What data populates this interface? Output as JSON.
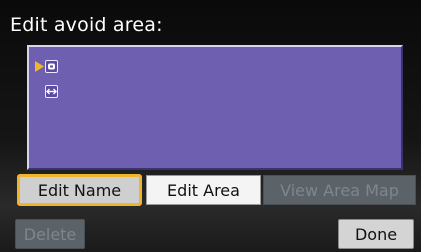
{
  "header": {
    "title": "Edit avoid area:"
  },
  "list": {
    "items": [
      {
        "icon": "avoid-area-icon",
        "selected": true
      },
      {
        "icon": "double-arrow-icon",
        "selected": false
      }
    ]
  },
  "buttons": {
    "edit_name": "Edit Name",
    "edit_area": "Edit Area",
    "view_area_map": "View Area Map",
    "delete": "Delete",
    "done": "Done"
  },
  "colors": {
    "list_background": "#6e5fb0",
    "focus_border": "#f0b62b",
    "cursor": "#f0b62b",
    "disabled_button": "#5b6268"
  }
}
